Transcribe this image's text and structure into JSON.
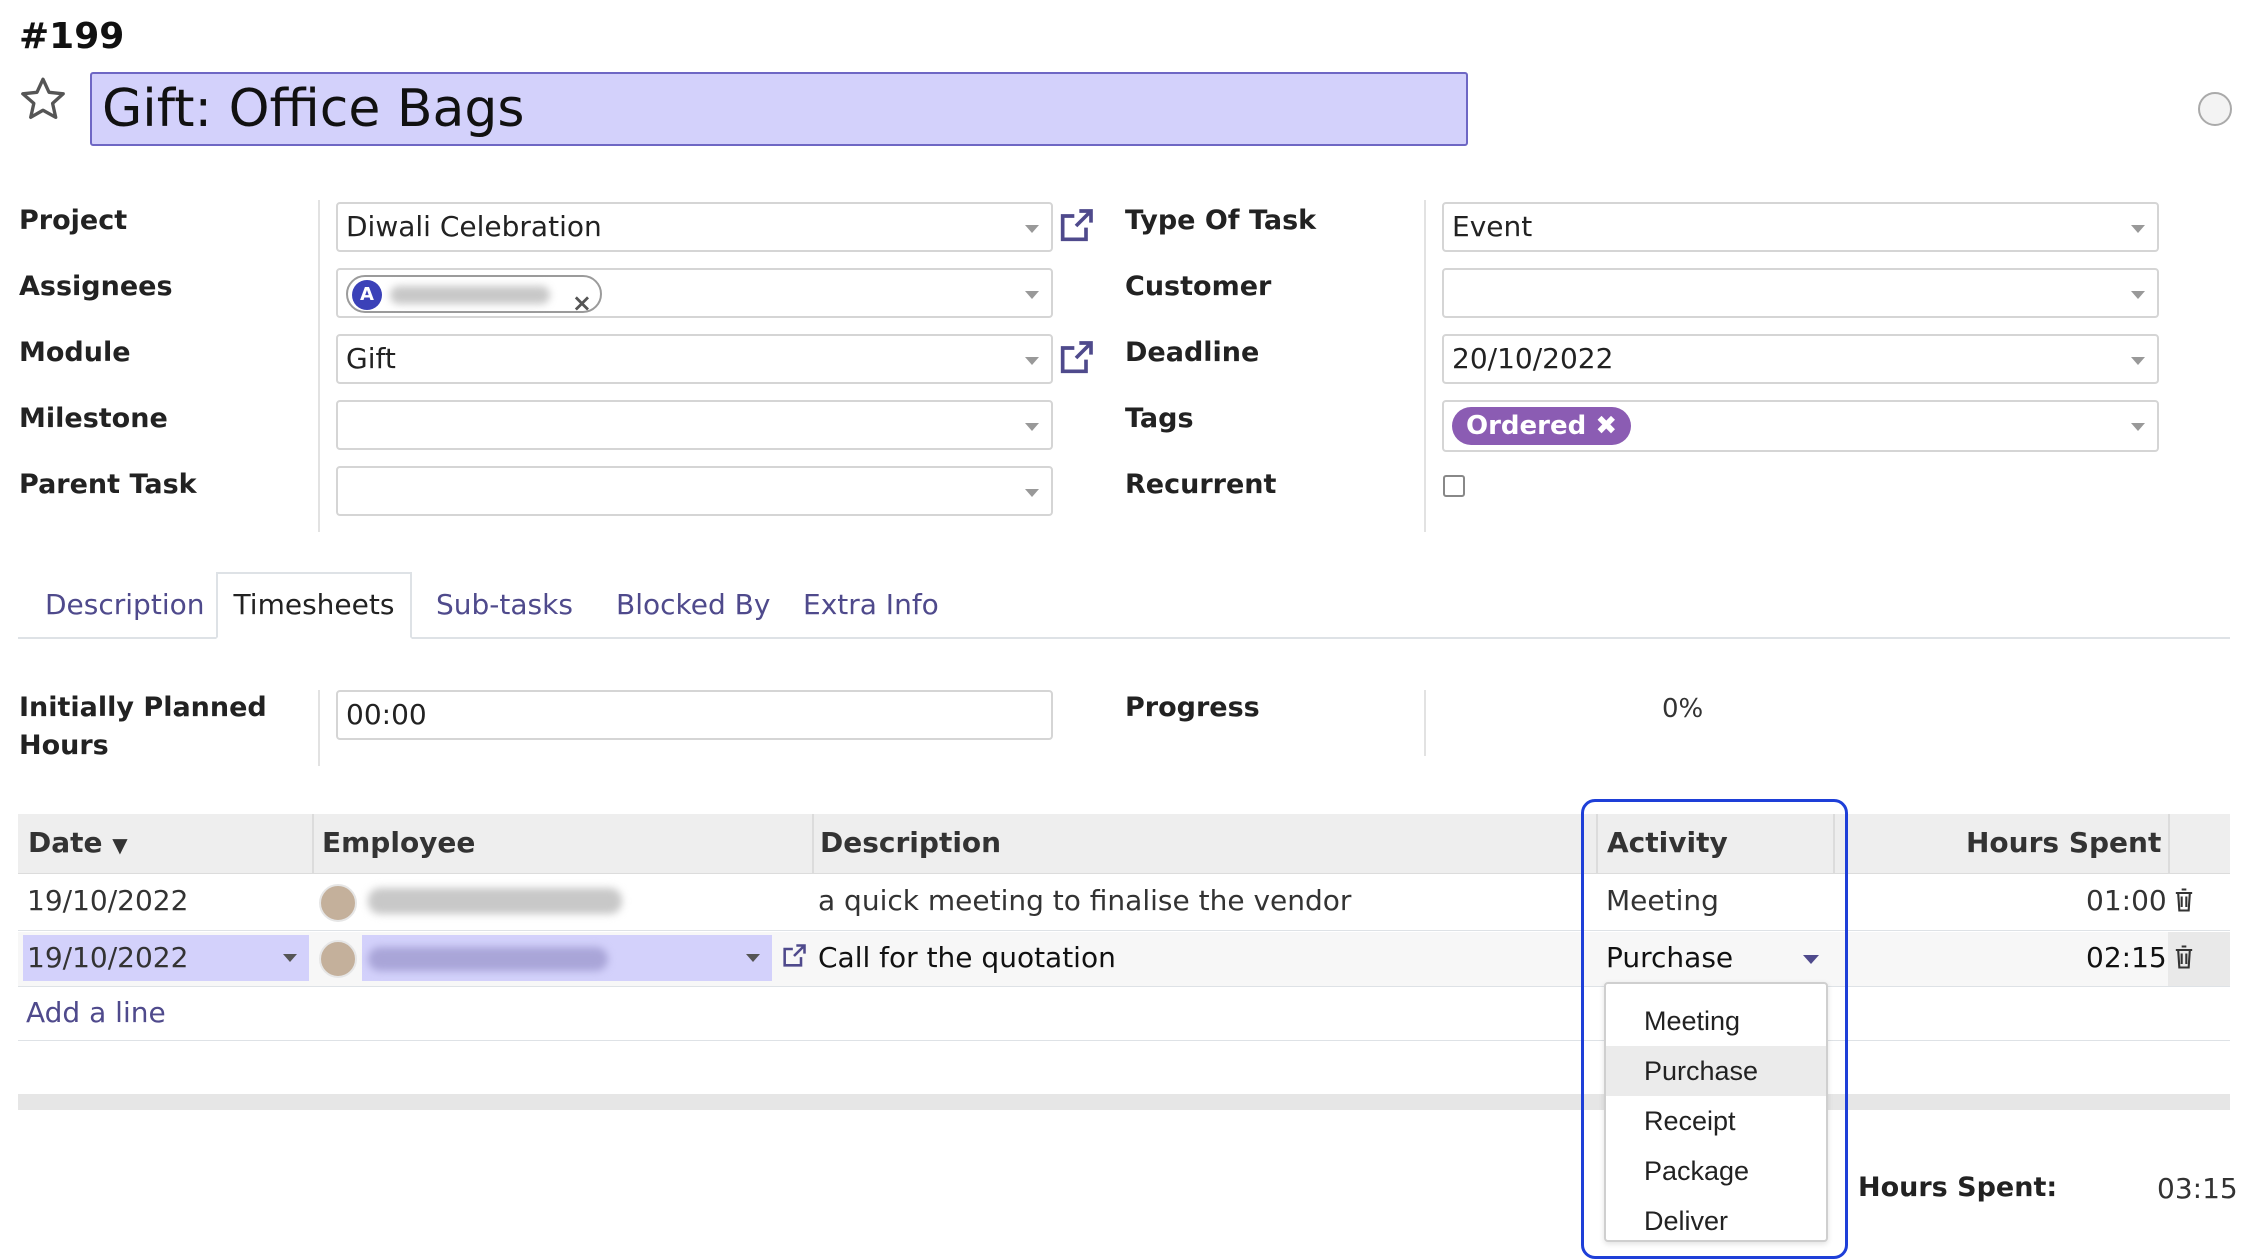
{
  "task": {
    "number": "#199",
    "title": "Gift: Office Bags"
  },
  "left_fields": {
    "project": {
      "label": "Project",
      "value": "Diwali Celebration"
    },
    "assignees": {
      "label": "Assignees",
      "chip_initial": "A"
    },
    "module": {
      "label": "Module",
      "value": "Gift"
    },
    "milestone": {
      "label": "Milestone",
      "value": ""
    },
    "parent_task": {
      "label": "Parent Task",
      "value": ""
    }
  },
  "right_fields": {
    "type_of_task": {
      "label": "Type Of Task",
      "value": "Event"
    },
    "customer": {
      "label": "Customer",
      "value": ""
    },
    "deadline": {
      "label": "Deadline",
      "value": "20/10/2022"
    },
    "tags": {
      "label": "Tags",
      "chip": "Ordered"
    },
    "recurrent": {
      "label": "Recurrent",
      "checked": false
    }
  },
  "tabs": [
    {
      "label": "Description",
      "active": false
    },
    {
      "label": "Timesheets",
      "active": true
    },
    {
      "label": "Sub-tasks",
      "active": false
    },
    {
      "label": "Blocked By",
      "active": false
    },
    {
      "label": "Extra Info",
      "active": false
    }
  ],
  "timesheets": {
    "planned_hours_label_line1": "Initially Planned",
    "planned_hours_label_line2": "Hours",
    "planned_hours_value": "00:00",
    "progress_label": "Progress",
    "progress_value": "0%",
    "columns": {
      "date": "Date",
      "employee": "Employee",
      "description": "Description",
      "activity": "Activity",
      "hours": "Hours Spent"
    },
    "rows": [
      {
        "date": "19/10/2022",
        "description": "a quick meeting to finalise the vendor",
        "activity": "Meeting",
        "hours": "01:00"
      },
      {
        "date": "19/10/2022",
        "description": "Call for the quotation",
        "activity": "Purchase",
        "hours": "02:15"
      }
    ],
    "add_line": "Add a line",
    "total_label": "Hours Spent:",
    "total_value": "03:15"
  },
  "activity_dropdown": {
    "options": [
      "Meeting",
      "Purchase",
      "Receipt",
      "Package",
      "Deliver"
    ],
    "selected": "Purchase"
  },
  "colors": {
    "accent": "#6e67c4",
    "title_bg": "#d3d1fb",
    "tag": "#8b5cb3",
    "highlight": "#1e3fd8"
  }
}
